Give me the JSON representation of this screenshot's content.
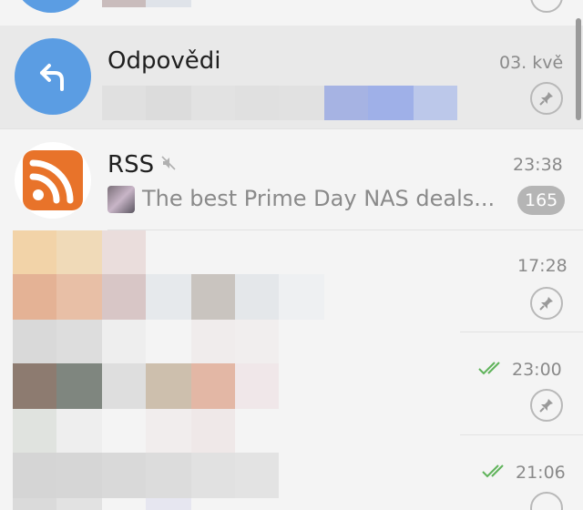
{
  "chats": [
    {
      "title": "Odpovědi",
      "time": "03. kvě",
      "pinned": true,
      "avatar_icon": "reply-arrow-icon",
      "avatar_color": "#5b9de3"
    },
    {
      "title": "RSS",
      "muted": true,
      "time": "23:38",
      "preview": "The best Prime Day NAS deals...",
      "unread_count": "165",
      "avatar_icon": "rss-icon",
      "avatar_color": "#e8732a"
    },
    {
      "time": "17:28",
      "pinned": true
    },
    {
      "time": "23:00",
      "pinned": true,
      "read_status": "double-check"
    },
    {
      "time": "21:06",
      "pinned": true,
      "read_status": "double-check"
    }
  ],
  "colors": {
    "check": "#5fb35a",
    "highlight_row": "#e9e9e9"
  }
}
